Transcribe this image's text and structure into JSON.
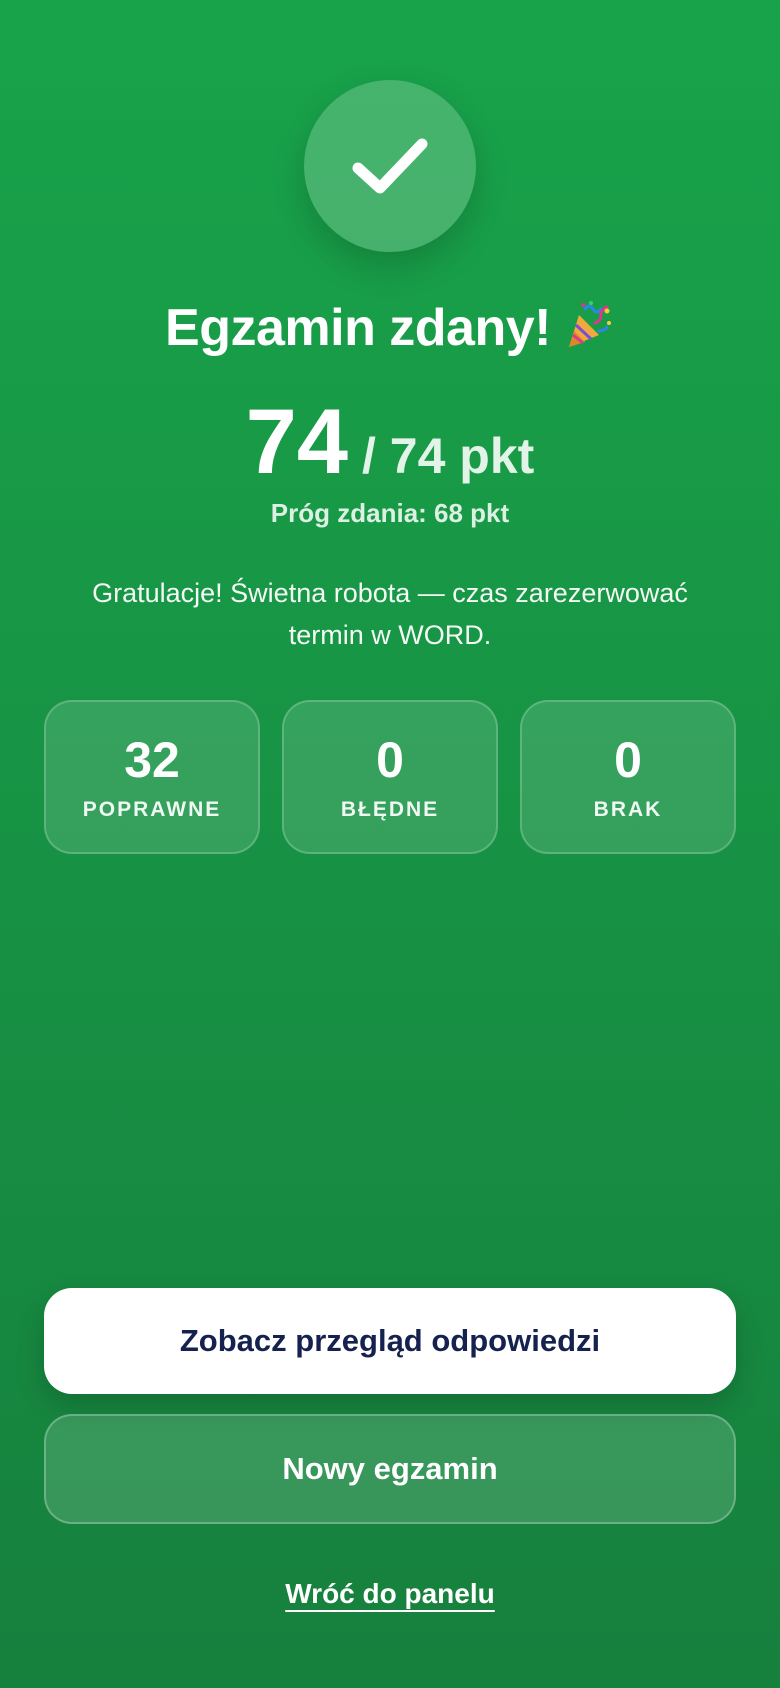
{
  "result": {
    "title": "Egzamin zdany!",
    "title_icon": "party-popper-icon",
    "status_icon": "checkmark-icon",
    "score": "74",
    "score_total": "/ 74 pkt",
    "threshold": "Próg zdania: 68 pkt",
    "message": "Gratulacje! Świetna robota — czas zarezerwować termin w WORD."
  },
  "stats": [
    {
      "value": "32",
      "label": "POPRAWNE"
    },
    {
      "value": "0",
      "label": "BŁĘDNE"
    },
    {
      "value": "0",
      "label": "BRAK"
    }
  ],
  "actions": {
    "review_label": "Zobacz przegląd odpowiedzi",
    "new_exam_label": "Nowy egzamin",
    "back_label": "Wróć do panelu"
  },
  "colors": {
    "background_top": "#18a34a",
    "background_bottom": "#16803d",
    "primary_button_text": "#15224f",
    "primary_button_bg": "#ffffff"
  }
}
